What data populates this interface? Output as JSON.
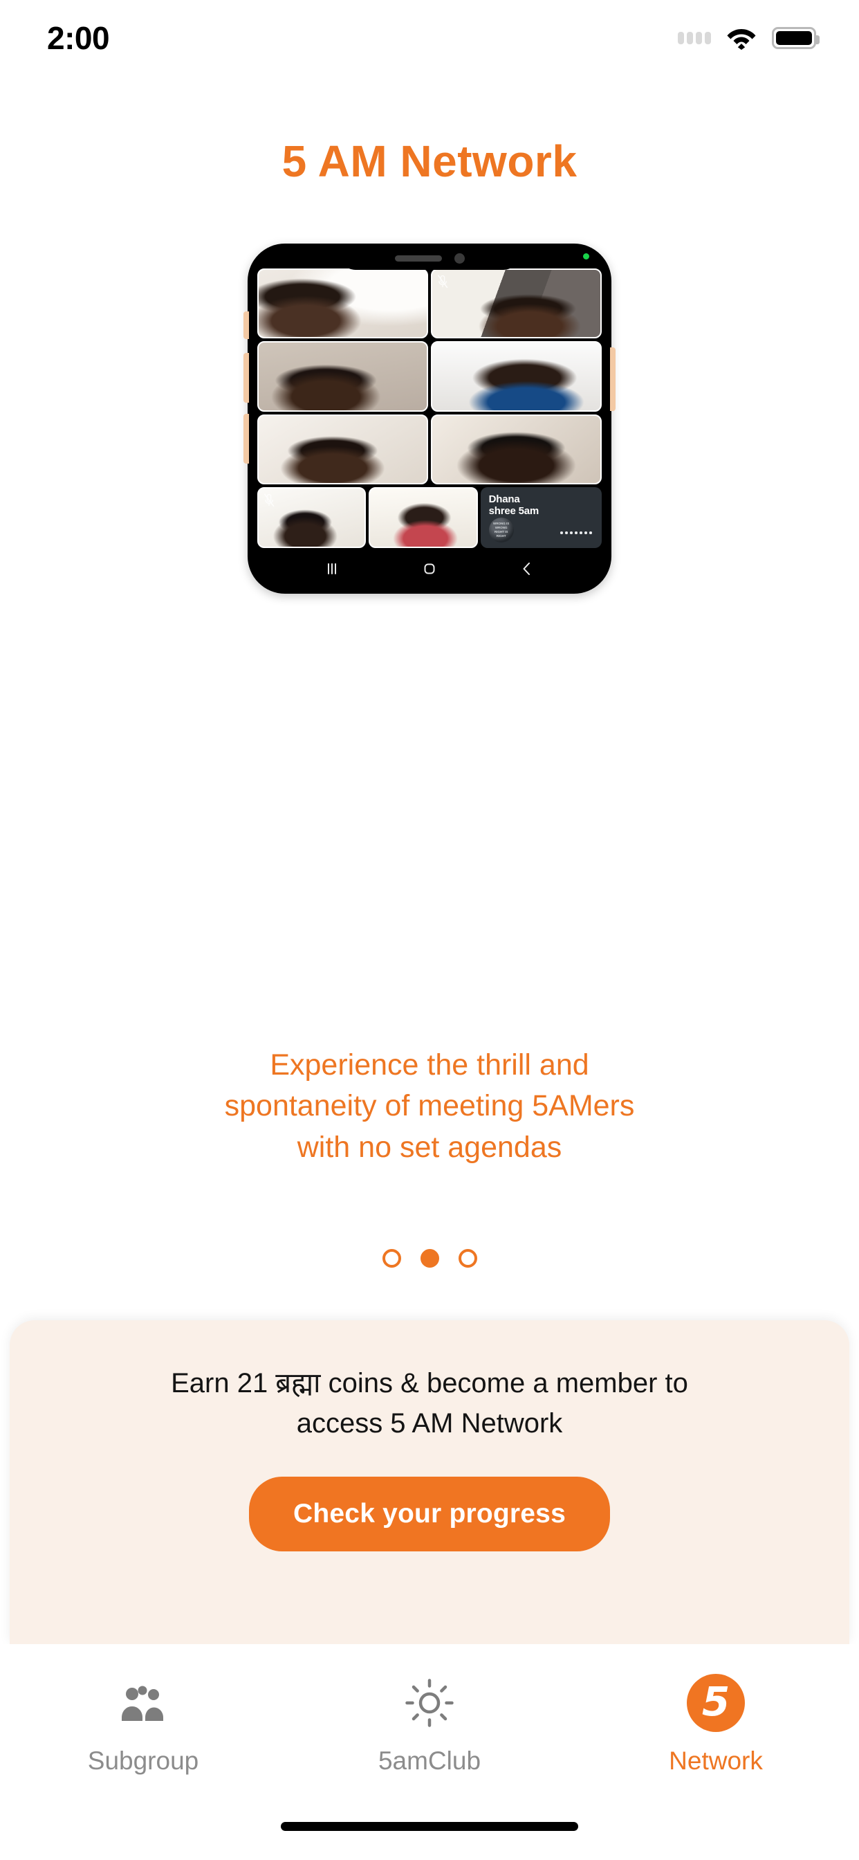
{
  "status_bar": {
    "time": "2:00",
    "signal_icon": "signal-dots-icon",
    "wifi_icon": "wifi-icon",
    "battery_icon": "battery-full-icon"
  },
  "header": {
    "title": "5 AM Network"
  },
  "hero": {
    "device_mockup": "phone-mockup",
    "video_grid": {
      "rows": [
        [
          {
            "id": "tile-1"
          },
          {
            "id": "tile-2"
          }
        ],
        [
          {
            "id": "tile-3"
          },
          {
            "id": "tile-4"
          }
        ],
        [
          {
            "id": "tile-5"
          },
          {
            "id": "tile-6"
          }
        ],
        [
          {
            "id": "tile-7"
          },
          {
            "id": "tile-8"
          },
          {
            "id": "tile-name"
          }
        ]
      ],
      "name_tile": {
        "name_line1": "Dhana",
        "name_line2": "shree 5am",
        "avatar_line1": "WRONG IS",
        "avatar_line2": "WRONG",
        "avatar_line3": "RIGHT IS",
        "avatar_line4": "RIGHT"
      }
    },
    "android_nav": {
      "recents": "recent-apps-icon",
      "home": "home-icon",
      "back": "back-icon"
    }
  },
  "tagline": {
    "line1": "Experience the thrill and",
    "line2": "spontaneity of meeting 5AMers",
    "line3": "with no set agendas"
  },
  "carousel": {
    "total": 3,
    "active_index": 1
  },
  "promo": {
    "line1": "Earn 21 ब्रह्मा coins & become a member to",
    "line2": "access 5 AM Network",
    "cta_label": "Check your progress"
  },
  "tab_bar": {
    "items": [
      {
        "label": "Subgroup",
        "icon": "people-group-icon",
        "active": false
      },
      {
        "label": "5amClub",
        "icon": "sun-icon",
        "active": false
      },
      {
        "label": "Network",
        "icon": "five-badge-icon",
        "active": true,
        "badge_text": "5"
      }
    ]
  },
  "colors": {
    "accent": "#ee7622",
    "cta": "#f07522",
    "promo_bg": "#faf0e8",
    "inactive_tab": "#8c8c8c",
    "name_tile_bg": "#2b3137"
  }
}
